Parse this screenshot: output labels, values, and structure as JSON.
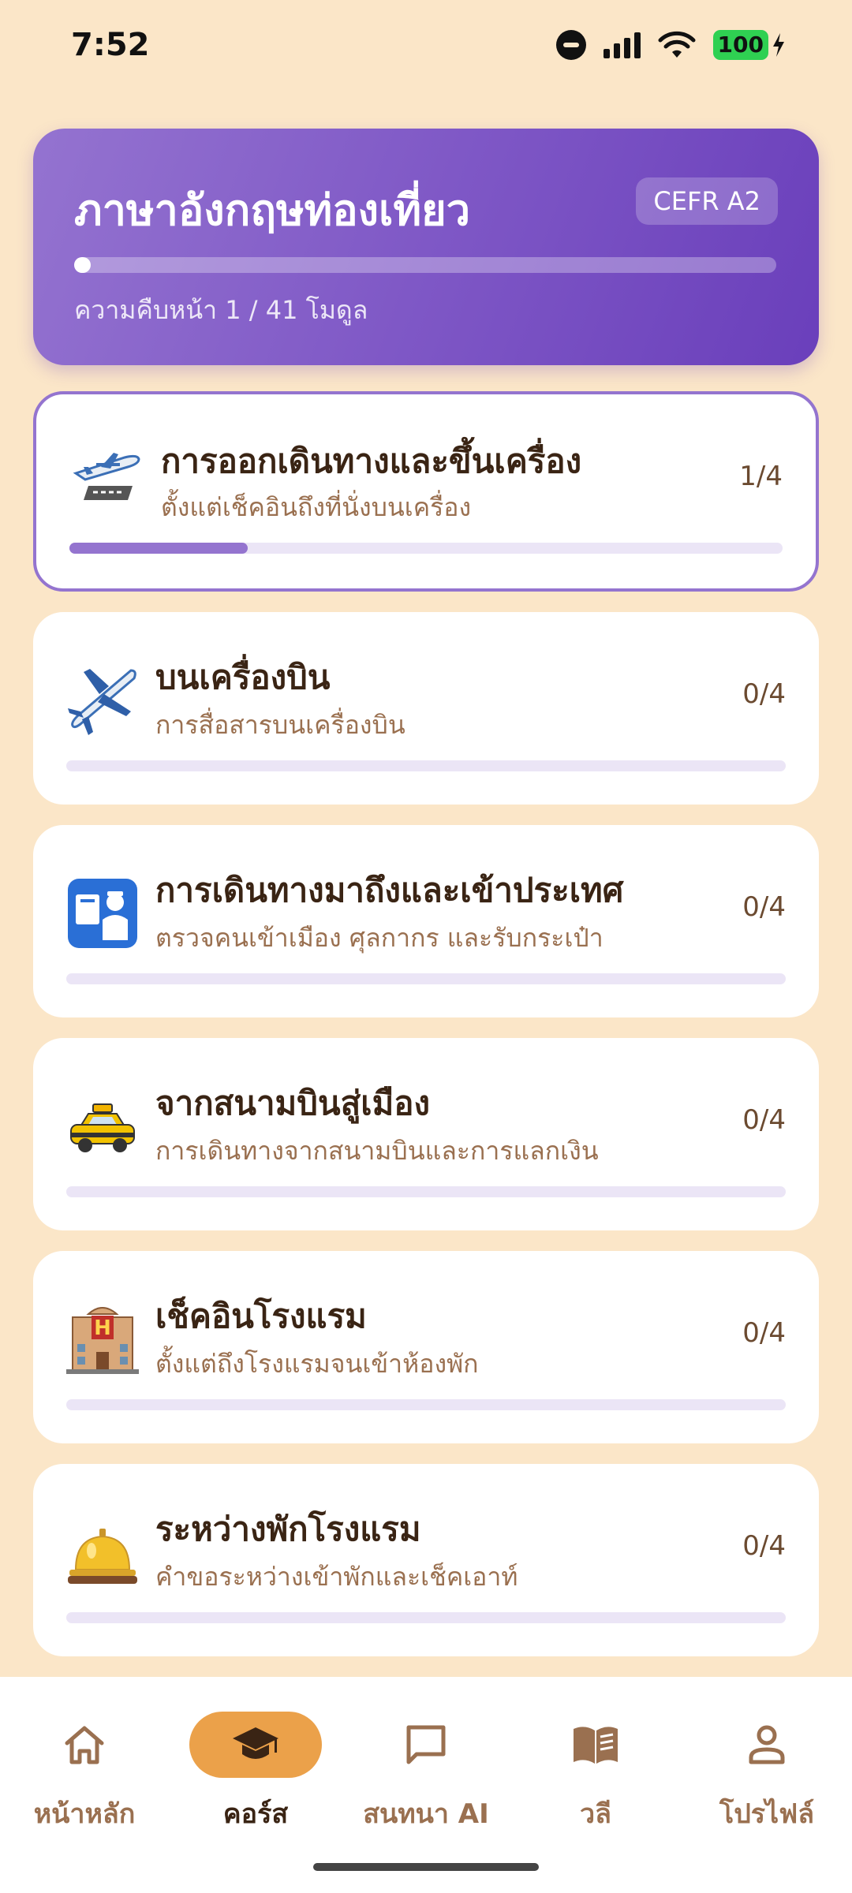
{
  "status_bar": {
    "time": "7:52",
    "battery": "100"
  },
  "course": {
    "title": "ภาษาอังกฤษท่องเที่ยว",
    "level_badge": "CEFR A2",
    "progress_text": "ความคืบหน้า 1 / 41 โมดูล",
    "progress_fraction": 0.024
  },
  "modules": [
    {
      "title": "การออกเดินทางและขึ้นเครื่อง",
      "subtitle": "ตั้งแต่เช็คอินถึงที่นั่งบนเครื่อง",
      "count": "1/4",
      "progress": 0.25,
      "icon": "airplane-departure-icon",
      "active": true
    },
    {
      "title": "บนเครื่องบิน",
      "subtitle": "การสื่อสารบนเครื่องบิน",
      "count": "0/4",
      "progress": 0,
      "icon": "airplane-icon",
      "active": false
    },
    {
      "title": "การเดินทางมาถึงและเข้าประเทศ",
      "subtitle": "ตรวจคนเข้าเมือง ศุลกากร และรับกระเป๋า",
      "count": "0/4",
      "progress": 0,
      "icon": "passport-control-icon",
      "active": false
    },
    {
      "title": "จากสนามบินสู่เมือง",
      "subtitle": "การเดินทางจากสนามบินและการแลกเงิน",
      "count": "0/4",
      "progress": 0,
      "icon": "taxi-icon",
      "active": false
    },
    {
      "title": "เช็คอินโรงแรม",
      "subtitle": "ตั้งแต่ถึงโรงแรมจนเข้าห้องพัก",
      "count": "0/4",
      "progress": 0,
      "icon": "hotel-icon",
      "active": false
    },
    {
      "title": "ระหว่างพักโรงแรม",
      "subtitle": "คำขอระหว่างเข้าพักและเช็คเอาท์",
      "count": "0/4",
      "progress": 0,
      "icon": "bellhop-bell-icon",
      "active": false
    }
  ],
  "nav": {
    "home": "หน้าหลัก",
    "courses": "คอร์ส",
    "ai_chat": "สนทนา AI",
    "phrases": "วลี",
    "profile": "โปรไฟล์",
    "active": "courses"
  },
  "colors": {
    "background": "#fbe6c8",
    "accent_purple": "#7f58c6",
    "nav_active": "#eba14a"
  }
}
